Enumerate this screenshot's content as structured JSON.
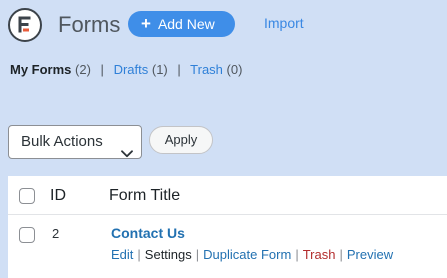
{
  "header": {
    "title": "Forms",
    "add_new_label": "Add New",
    "import_label": "Import"
  },
  "filters": {
    "my_forms_label": "My Forms",
    "my_forms_count": "(2)",
    "drafts_label": "Drafts",
    "drafts_count": "(1)",
    "trash_label": "Trash",
    "trash_count": "(0)",
    "separator": "|"
  },
  "bulk": {
    "selected": "Bulk Actions",
    "apply_label": "Apply"
  },
  "table": {
    "columns": [
      "ID",
      "Form Title"
    ],
    "rows": [
      {
        "id": "2",
        "title": "Contact Us",
        "actions": [
          "Edit",
          "Settings",
          "Duplicate Form",
          "Trash",
          "Preview"
        ]
      }
    ]
  },
  "colors": {
    "page_bg": "#d0dff5",
    "accent": "#3f8ee8",
    "link": "#2271b1",
    "trash": "#b32d2e"
  },
  "icons": {
    "logo": "formidable-logo-icon",
    "add": "plus-icon",
    "select_arrow": "chevron-down-icon"
  }
}
